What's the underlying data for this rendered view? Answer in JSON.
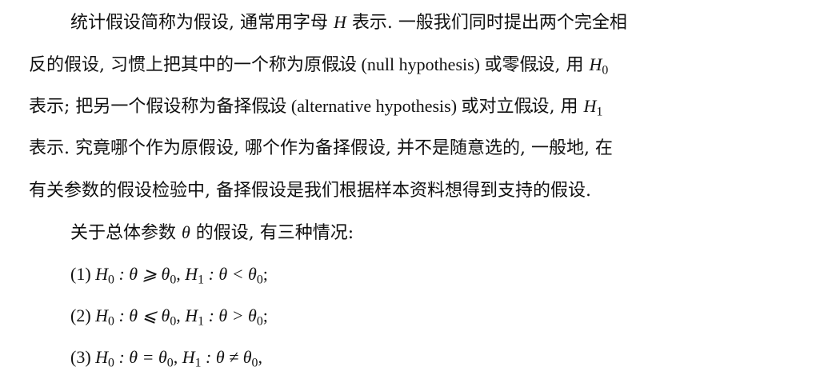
{
  "paragraph1": {
    "l1_a": "统计假设简称为假设, 通常用字母 ",
    "l1_H": "H",
    "l1_b": " 表示. 一般我们同时提出两个完全相",
    "l2_a": "反的假设, 习惯上把其中的一个称为原",
    "l2_dot": "假设",
    "l2_latin": " (null hypothesis) ",
    "l2_b": "或零",
    "l2_dot2": "假设",
    "l2_c": ", 用 ",
    "l2_H": "H",
    "l2_sub": "0",
    "l3_a": "表示; 把另一个假设称为备择",
    "l3_dot": "假设",
    "l3_latin": " (alternative hypothesis) ",
    "l3_b": "或对立",
    "l3_dot2": "假设",
    "l3_c": ", 用 ",
    "l3_H": "H",
    "l3_sub": "1",
    "l4": "表示. 究竟哪个作为原假设, 哪个作为备择假设, 并不是随意选的, 一般地, 在",
    "l5": "有关参数的假设检验中, 备择假设是我们根据样本资料想得到支持的假设."
  },
  "paragraph2": {
    "intro_a": "关于总体参数 ",
    "theta": "θ",
    "intro_b": " 的假设, 有三种情况:"
  },
  "cases": [
    {
      "num": "(1) ",
      "H0": "H",
      "s0": "0",
      "rel0": " : θ ⩾ θ",
      "t0": "0",
      "sep": ", ",
      "H1": "H",
      "s1": "1",
      "rel1": " : θ < θ",
      "t1": "0",
      "end": ";"
    },
    {
      "num": "(2) ",
      "H0": "H",
      "s0": "0",
      "rel0": " : θ ⩽ θ",
      "t0": "0",
      "sep": ", ",
      "H1": "H",
      "s1": "1",
      "rel1": " : θ > θ",
      "t1": "0",
      "end": ";"
    },
    {
      "num": "(3) ",
      "H0": "H",
      "s0": "0",
      "rel0": " : θ = θ",
      "t0": "0",
      "sep": ", ",
      "H1": "H",
      "s1": "1",
      "rel1": " : θ ≠ θ",
      "t1": "0",
      "end": ","
    }
  ]
}
